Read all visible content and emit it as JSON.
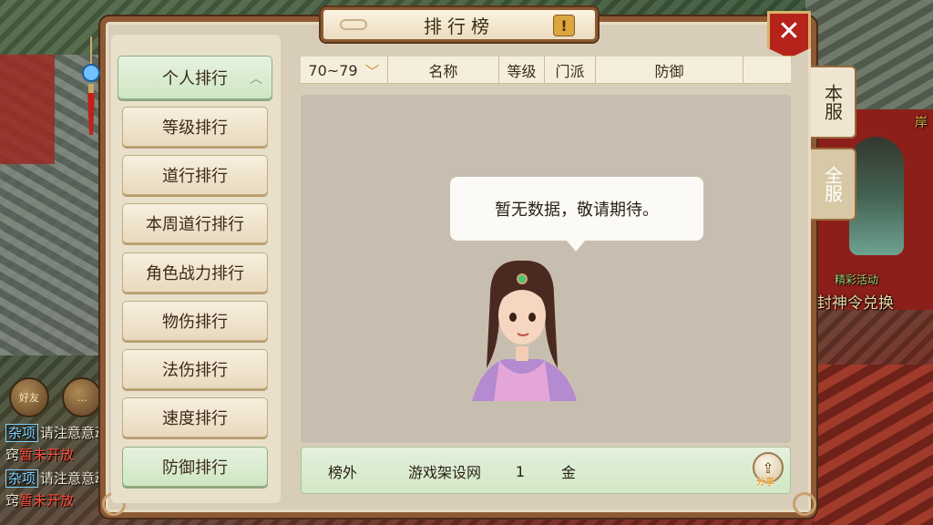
{
  "title": "排行榜",
  "title_badge": "!",
  "close_label": "✕",
  "sidebar": {
    "items": [
      {
        "label": "个人排行",
        "active": true
      },
      {
        "label": "等级排行"
      },
      {
        "label": "道行排行"
      },
      {
        "label": "本周道行排行"
      },
      {
        "label": "角色战力排行"
      },
      {
        "label": "物伤排行"
      },
      {
        "label": "法伤排行"
      },
      {
        "label": "速度排行"
      },
      {
        "label": "防御排行",
        "selected": true
      }
    ]
  },
  "server_tabs": [
    {
      "label": "本服",
      "active": true
    },
    {
      "label": "全服",
      "active": false
    }
  ],
  "table": {
    "level_range": "70~79",
    "columns": [
      "名称",
      "等级",
      "门派",
      "防御"
    ]
  },
  "empty_message": "暂无数据，敬请期待。",
  "footer": {
    "rank": "榜外",
    "name": "游戏架设网",
    "level": "1",
    "school": "金",
    "share_label": "分享"
  },
  "world": {
    "labels": [
      "封神令兑换",
      "精彩活动",
      "岸"
    ],
    "chat": [
      {
        "tag": "杂项",
        "text": "请注意意动"
      },
      {
        "text": "窍",
        "red": "暂未开放"
      },
      {
        "tag": "杂项",
        "text": "请注意意动"
      },
      {
        "text": "窍",
        "red": "暂未开放"
      }
    ],
    "hud": [
      "好友",
      "…"
    ]
  },
  "colors": {
    "frame": "#8c5a35",
    "panel": "#d8cdb8",
    "active_tab": "#cfe6c4",
    "close": "#b5231b"
  }
}
